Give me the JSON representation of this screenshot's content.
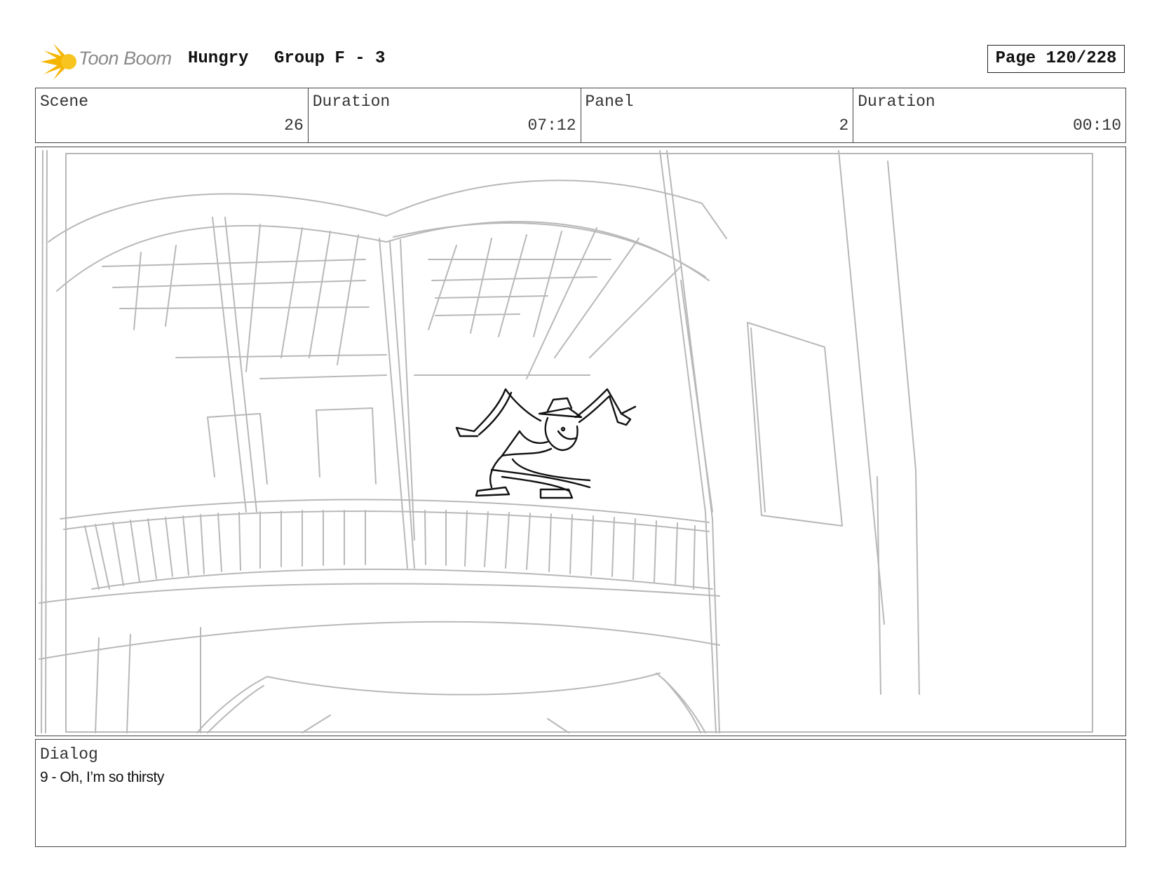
{
  "header": {
    "logo_text": "Toon Boom",
    "project": "Hungry",
    "group": "Group F - 3",
    "page": "Page 120/228"
  },
  "info": {
    "scene_label": "Scene",
    "scene_value": "26",
    "scene_duration_label": "Duration",
    "scene_duration_value": "07:12",
    "panel_label": "Panel",
    "panel_value": "2",
    "panel_duration_label": "Duration",
    "panel_duration_value": "00:10"
  },
  "dialog": {
    "label": "Dialog",
    "text": "9 - Oh, I’m so thirsty"
  },
  "colors": {
    "sketch_gray": "#b5b5b5",
    "figure_black": "#111111",
    "logo_yellow": "#f5b400"
  }
}
